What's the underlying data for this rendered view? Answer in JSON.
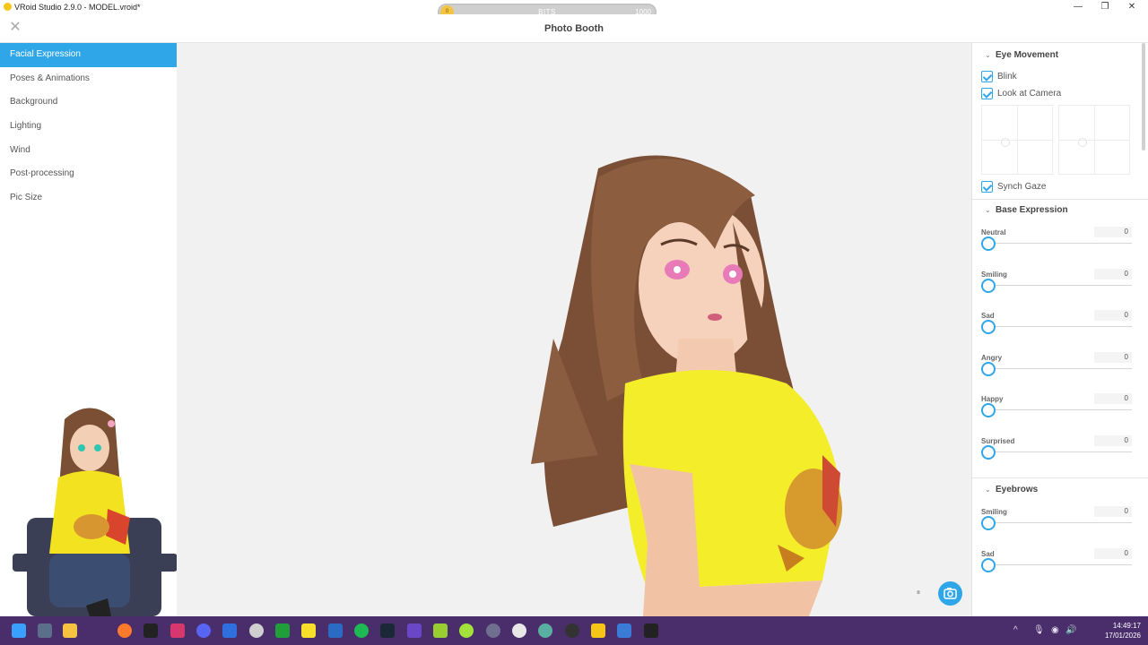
{
  "window": {
    "title": "VRoid Studio 2.9.0 - MODEL.vroid*",
    "minimize": "—",
    "maximize": "❐",
    "close": "✕"
  },
  "bits": {
    "label": "BITS",
    "value": "0",
    "max": "1000",
    "progress": 0
  },
  "header": {
    "title": "Photo Booth",
    "close_glyph": "✕"
  },
  "sidebar": {
    "items": [
      {
        "label": "Facial Expression",
        "active": true
      },
      {
        "label": "Poses & Animations"
      },
      {
        "label": "Background"
      },
      {
        "label": "Lighting"
      },
      {
        "label": "Wind"
      },
      {
        "label": "Post-processing"
      },
      {
        "label": "Pic Size"
      }
    ]
  },
  "viewport": {
    "pause_glyph": "⏸",
    "camera_icon": "camera-icon"
  },
  "panel": {
    "eye_movement": {
      "title": "Eye Movement",
      "blink": "Blink",
      "look_at_camera": "Look at Camera",
      "synch_gaze": "Synch Gaze"
    },
    "base_expression": {
      "title": "Base Expression",
      "sliders": [
        {
          "name": "Neutral",
          "value": "0"
        },
        {
          "name": "Smiling",
          "value": "0"
        },
        {
          "name": "Sad",
          "value": "0"
        },
        {
          "name": "Angry",
          "value": "0"
        },
        {
          "name": "Happy",
          "value": "0"
        },
        {
          "name": "Surprised",
          "value": "0"
        }
      ]
    },
    "eyebrows": {
      "title": "Eyebrows",
      "sliders": [
        {
          "name": "Smiling",
          "value": "0"
        },
        {
          "name": "Sad",
          "value": "0"
        }
      ]
    }
  },
  "taskbar": {
    "clock_time": "14:49:17",
    "clock_date": "17/01/2026",
    "tray_up": "^"
  },
  "colors": {
    "accent": "#2fa6e8",
    "taskbar": "#4a2d6b"
  }
}
